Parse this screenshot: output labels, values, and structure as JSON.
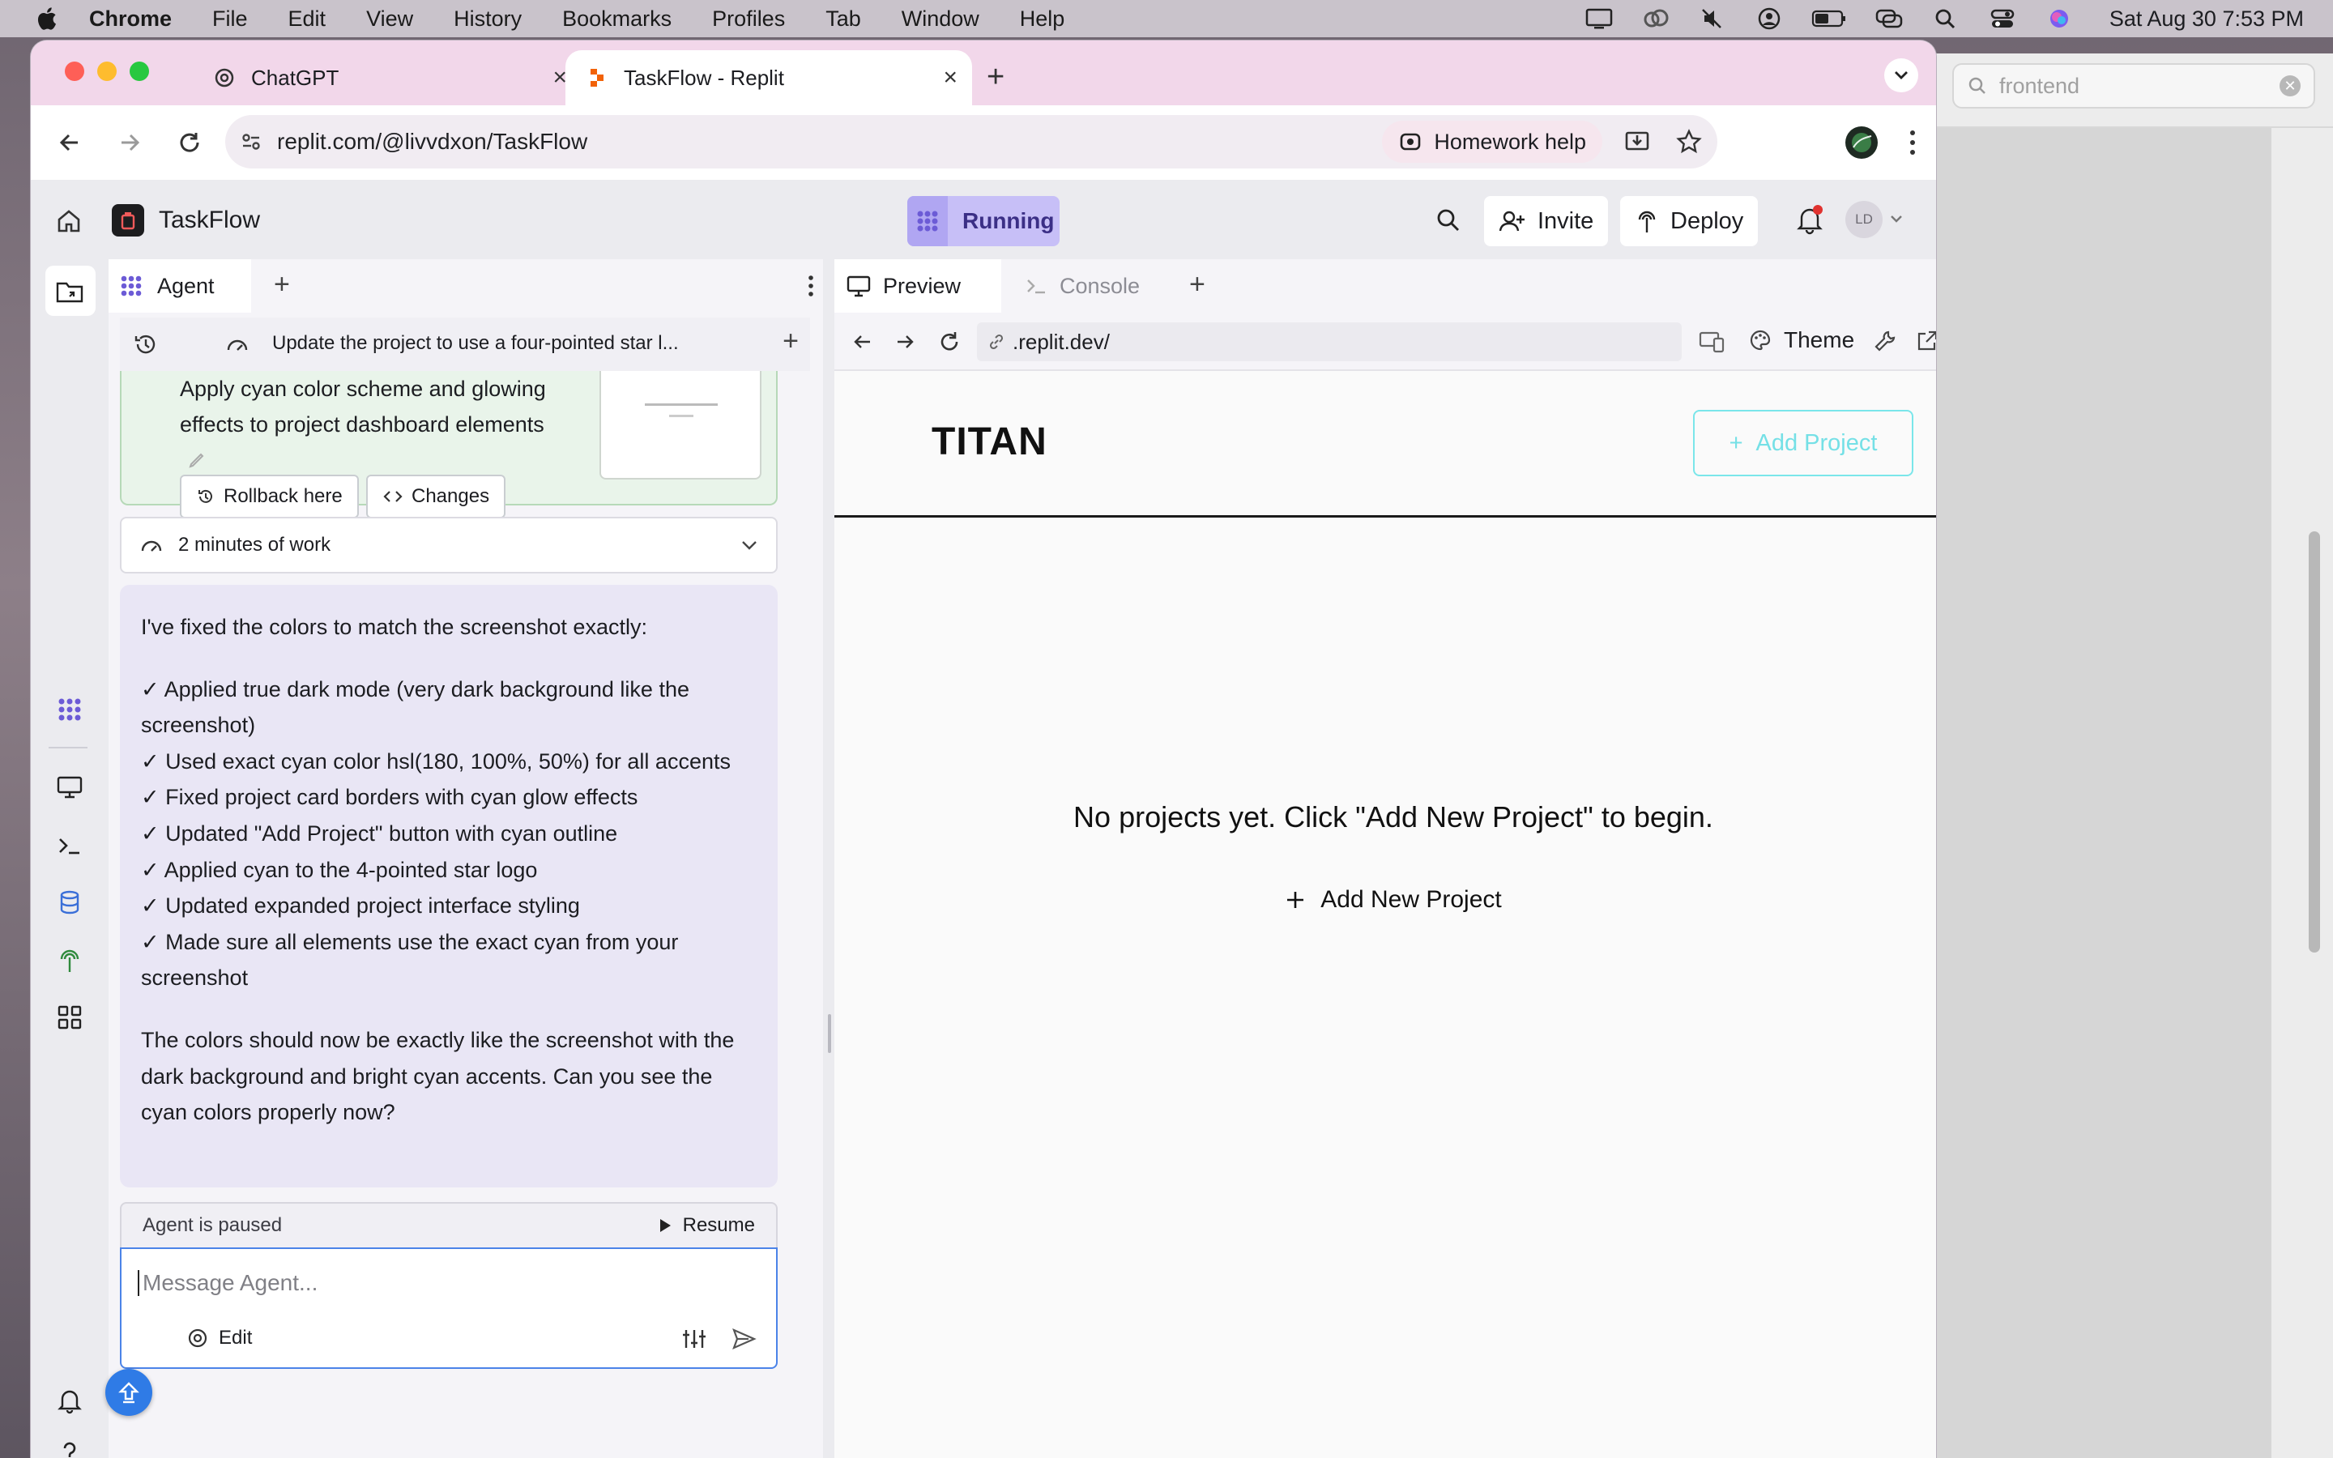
{
  "menubar": {
    "app": "Chrome",
    "items": [
      "File",
      "Edit",
      "View",
      "History",
      "Bookmarks",
      "Profiles",
      "Tab",
      "Window",
      "Help"
    ],
    "clock": "Sat Aug 30  7:53 PM"
  },
  "background_window": {
    "search_value": "frontend"
  },
  "browser": {
    "tabs": [
      {
        "title": "ChatGPT",
        "icon": "openai-icon"
      },
      {
        "title": "TaskFlow - Replit",
        "icon": "replit-icon",
        "active": true
      }
    ],
    "url": "replit.com/@livvdxon/TaskFlow",
    "homework_label": "Homework help"
  },
  "app": {
    "project_name": "TaskFlow",
    "status": "Running",
    "invite_label": "Invite",
    "deploy_label": "Deploy",
    "avatar_initials": "LD",
    "accent": "#c7bff7"
  },
  "agent": {
    "tab_label": "Agent",
    "thread_title": "Update the project to use a four-pointed star l...",
    "checkpoint": {
      "text": "Apply cyan color scheme and glowing effects to project dashboard elements",
      "rollback_label": "Rollback here",
      "changes_label": "Changes"
    },
    "work_label": "2 minutes of work",
    "message": {
      "intro": "I've fixed the colors to match the screenshot exactly:",
      "bullets": [
        "✓ Applied true dark mode (very dark background like the screenshot)",
        "✓ Used exact cyan color hsl(180, 100%, 50%) for all accents",
        "✓ Fixed project card borders with cyan glow effects",
        "✓ Updated \"Add Project\" button with cyan outline",
        "✓ Applied cyan to the 4-pointed star logo",
        "✓ Updated expanded project interface styling",
        "✓ Made sure all elements use the exact cyan from your screenshot"
      ],
      "outro": "The colors should now be exactly like the screenshot with the dark background and bright cyan accents. Can you see the cyan colors properly now?"
    },
    "paused_label": "Agent is paused",
    "resume_label": "Resume",
    "input_placeholder": "Message Agent...",
    "edit_label": "Edit"
  },
  "preview": {
    "tab_preview": "Preview",
    "tab_console": "Console",
    "url": ".replit.dev/",
    "theme_label": "Theme",
    "site": {
      "brand": "TITAN",
      "add_project_label": "Add Project",
      "empty_text": "No projects yet. Click \"Add New Project\" to begin.",
      "add_new_label": "Add New Project",
      "accent": "#75e0e6"
    }
  }
}
